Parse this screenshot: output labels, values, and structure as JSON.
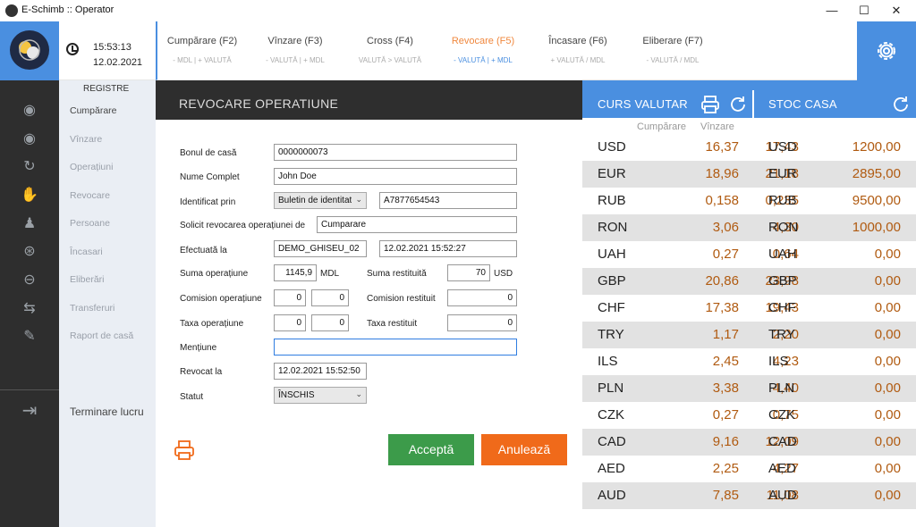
{
  "window": {
    "title": "E-Schimb :: Operator",
    "minimize": "—",
    "maximize": "☐",
    "close": "✕"
  },
  "clock": {
    "time": "15:53:13",
    "date": "12.02.2021"
  },
  "nav": [
    {
      "label": "Cumpărare (F2)",
      "sub": "- MDL | + VALUTĂ"
    },
    {
      "label": "Vînzare (F3)",
      "sub": "- VALUTĂ | + MDL"
    },
    {
      "label": "Cross (F4)",
      "sub": "VALUTĂ > VALUTĂ"
    },
    {
      "label": "Revocare (F5)",
      "sub": "- VALUTĂ | + MDL"
    },
    {
      "label": "Încasare (F6)",
      "sub": "+ VALUTĂ / MDL"
    },
    {
      "label": "Eliberare (F7)",
      "sub": "- VALUTĂ / MDL"
    }
  ],
  "menu": {
    "head": "REGISTRE",
    "items": [
      "Cumpărare",
      "Vînzare",
      "Operațiuni",
      "Revocare",
      "Persoane",
      "Încasari",
      "Eliberări",
      "Transferuri",
      "Raport de casă"
    ],
    "logout": "Terminare lucru"
  },
  "form": {
    "title": "REVOCARE OPERATIUNE",
    "bon_label": "Bonul de casă",
    "bon_value": "0000000073",
    "nume_label": "Nume Complet",
    "nume_value": "John Doe",
    "ident_label": "Identificat prin",
    "ident_select": "Buletin de identitate",
    "ident_value": "A7877654543",
    "solicit_label": "Solicit revocarea operațiunei de",
    "solicit_value": "Cumparare",
    "efect_label": "Efectuată la",
    "efect_value": "DEMO_GHISEU_02",
    "efect_date": "12.02.2021 15:52:27",
    "suma_label": "Suma operațiune",
    "suma_value": "1145,9",
    "suma_cur": "MDL",
    "suma_rest_label": "Suma restituită",
    "suma_rest_value": "70",
    "suma_rest_cur": "USD",
    "comision_label": "Comision operațiune",
    "comision_v1": "0",
    "comision_v2": "0",
    "comision_rest_label": "Comision restituit",
    "comision_rest_value": "0",
    "taxa_label": "Taxa operațiune",
    "taxa_v1": "0",
    "taxa_v2": "0",
    "taxa_rest_label": "Taxa restituit",
    "taxa_rest_value": "0",
    "mentiune_label": "Mențiune",
    "mentiune_value": "",
    "revocat_label": "Revocat la",
    "revocat_value": "12.02.2021 15:52:50",
    "statut_label": "Statut",
    "statut_value": "ÎNSCHIS",
    "accept": "Acceptă",
    "cancel": "Anulează"
  },
  "rates": {
    "title": "CURS VALUTAR",
    "stock_title": "STOC CASA",
    "buy_header": "Cumpărare",
    "sell_header": "Vînzare",
    "rows": [
      {
        "cur": "USD",
        "buy": "16,37",
        "sell": "17,43",
        "stock": "1200,00"
      },
      {
        "cur": "EUR",
        "buy": "18,96",
        "sell": "21,18",
        "stock": "2895,00"
      },
      {
        "cur": "RUB",
        "buy": "0,158",
        "sell": "0,235",
        "stock": "9500,00"
      },
      {
        "cur": "RON",
        "buy": "3,06",
        "sell": "4,30",
        "stock": "1000,00"
      },
      {
        "cur": "UAH",
        "buy": "0,27",
        "sell": "0,64",
        "stock": "0,00"
      },
      {
        "cur": "GBP",
        "buy": "20,86",
        "sell": "23,98",
        "stock": "0,00"
      },
      {
        "cur": "CHF",
        "buy": "17,38",
        "sell": "19,43",
        "stock": "0,00"
      },
      {
        "cur": "TRY",
        "buy": "1,17",
        "sell": "2,20",
        "stock": "0,00"
      },
      {
        "cur": "ILS",
        "buy": "2,45",
        "sell": "4,23",
        "stock": "0,00"
      },
      {
        "cur": "PLN",
        "buy": "3,38",
        "sell": "4,40",
        "stock": "0,00"
      },
      {
        "cur": "CZK",
        "buy": "0,27",
        "sell": "0,75",
        "stock": "0,00"
      },
      {
        "cur": "CAD",
        "buy": "9,16",
        "sell": "12,09",
        "stock": "0,00"
      },
      {
        "cur": "AED",
        "buy": "2,25",
        "sell": "4,27",
        "stock": "0,00"
      },
      {
        "cur": "AUD",
        "buy": "7,85",
        "sell": "11,08",
        "stock": "0,00"
      }
    ]
  },
  "colors": {
    "accent": "#4a8fe0",
    "sidebar": "#2e2e2e",
    "accept": "#3c9b4a",
    "cancel": "#f06a1a",
    "active_tab": "#f0883e",
    "rate_value": "#b05a10"
  }
}
